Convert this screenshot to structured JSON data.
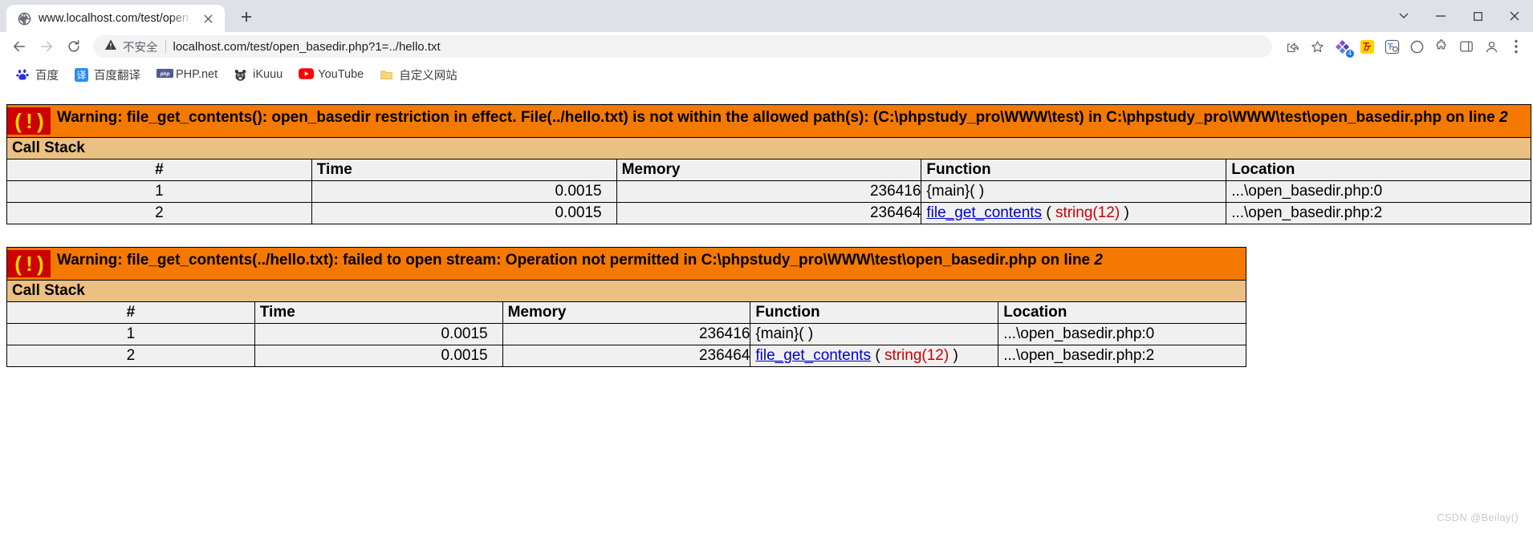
{
  "browser": {
    "tab": {
      "title": "www.localhost.com/test/open_",
      "favicon_name": "globe-icon",
      "close_label": "×"
    },
    "newtab_label": "+",
    "window_controls": {
      "minimize_to_tray_label": "⌄",
      "minimize_label": "–",
      "maximize_label": "☐",
      "close_label": "✕"
    },
    "toolbar": {
      "back_label": "←",
      "forward_label": "→",
      "reload_label": "↻",
      "security_warning_label": "不安全",
      "url": "localhost.com/test/open_basedir.php?1=../hello.txt",
      "share_label": "share-icon",
      "bookmark_star_label": "☆",
      "extension_badge": "4",
      "profile_label": "profile-icon",
      "menu_label": "⋮"
    },
    "bookmarks": [
      {
        "label": "百度",
        "icon": "baidu-icon"
      },
      {
        "label": "百度翻译",
        "icon": "baidu-fanyi-icon"
      },
      {
        "label": "PHP.net",
        "icon": "php-icon"
      },
      {
        "label": "iKuuu",
        "icon": "ikuuu-icon"
      },
      {
        "label": "YouTube",
        "icon": "youtube-icon"
      },
      {
        "label": "自定义网站",
        "icon": "folder-icon"
      }
    ]
  },
  "colors": {
    "error_bg": "#f57900",
    "error_icon_bg": "#cc0000",
    "error_icon_fg": "#ffd700",
    "callstack_head_bg": "#eac083",
    "table_bg": "#f0f0f0",
    "link": "#0000cc",
    "arg": "#cc0000"
  },
  "errors": [
    {
      "icon": "( ! )",
      "message_prefix": "Warning: file_get_contents(): open_basedir restriction in effect. File(../hello.txt) is not within the allowed path(s): (C:\\phpstudy_pro\\WWW\\test) in C:\\phpstudy_pro\\WWW\\test\\open_basedir.php on line ",
      "message_line_em": "2",
      "callstack_title": "Call Stack",
      "columns": [
        "#",
        "Time",
        "Memory",
        "Function",
        "Location"
      ],
      "rows": [
        {
          "num": "1",
          "time": "0.0015",
          "memory": "236416",
          "fn_link": "",
          "fn_text": "{main}( )",
          "fn_arg": "",
          "location": "...\\open_basedir.php:0"
        },
        {
          "num": "2",
          "time": "0.0015",
          "memory": "236464",
          "fn_link": "file_get_contents",
          "fn_text": " ( ",
          "fn_arg": "string(12)",
          "fn_suffix": " )",
          "location": "...\\open_basedir.php:2"
        }
      ]
    },
    {
      "icon": "( ! )",
      "message_prefix": "Warning: file_get_contents(../hello.txt): failed to open stream: Operation not permitted in C:\\phpstudy_pro\\WWW\\test\\open_basedir.php on line ",
      "message_line_em": "2",
      "callstack_title": "Call Stack",
      "columns": [
        "#",
        "Time",
        "Memory",
        "Function",
        "Location"
      ],
      "rows": [
        {
          "num": "1",
          "time": "0.0015",
          "memory": "236416",
          "fn_link": "",
          "fn_text": "{main}( )",
          "fn_arg": "",
          "location": "...\\open_basedir.php:0"
        },
        {
          "num": "2",
          "time": "0.0015",
          "memory": "236464",
          "fn_link": "file_get_contents",
          "fn_text": " ( ",
          "fn_arg": "string(12)",
          "fn_suffix": " )",
          "location": "...\\open_basedir.php:2"
        }
      ]
    }
  ],
  "watermark": "CSDN @Beilay()"
}
